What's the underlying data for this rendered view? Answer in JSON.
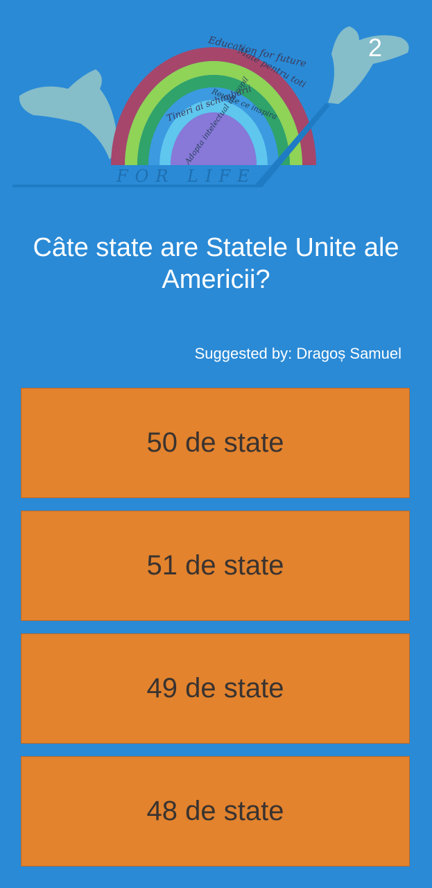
{
  "header": {
    "question_number": "2",
    "logo": {
      "arc_texts": [
        "Education for future",
        "Mate pentru toti",
        "Tineri ai schimbarii",
        "Reusite ce inspira",
        "Adopta intelectual un copil"
      ],
      "base_text": "FOR LIFE"
    }
  },
  "quiz": {
    "question": "Câte state are Statele Unite ale Americii?",
    "suggested_by": "Suggested by: Dragoș Samuel",
    "answers": [
      "50 de state",
      "51 de state",
      "49 de state",
      "48 de state"
    ]
  },
  "colors": {
    "background": "#2a8ad6",
    "answer_bg": "#e3832d",
    "answer_text": "#3a3330"
  }
}
